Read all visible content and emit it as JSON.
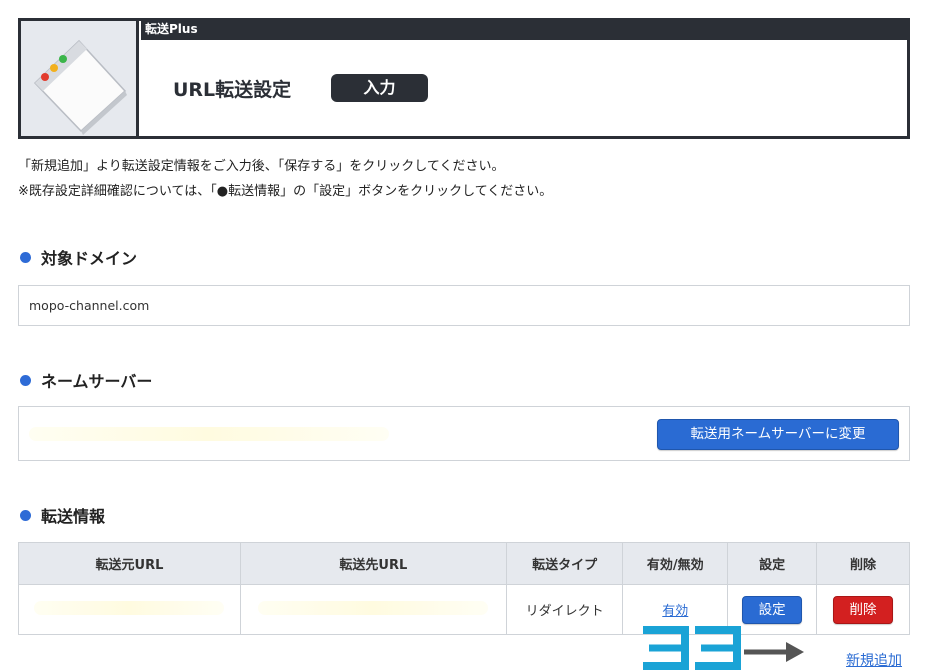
{
  "header": {
    "app_label": "転送Plus",
    "title": "URL転送設定",
    "mode_badge": "入力"
  },
  "instructions": {
    "line1": "「新規追加」より転送設定情報をご入力後、「保存する」をクリックしてください。",
    "line2": "※既存設定詳細確認については、「●転送情報」の「設定」ボタンをクリックしてください。"
  },
  "domain_section": {
    "heading": "対象ドメイン",
    "value": "mopo-channel.com"
  },
  "nameserver_section": {
    "heading": "ネームサーバー",
    "change_button": "転送用ネームサーバーに変更"
  },
  "transfer_section": {
    "heading": "転送情報",
    "columns": [
      "転送元URL",
      "転送先URL",
      "転送タイプ",
      "有効/無効",
      "設定",
      "削除"
    ],
    "rows": [
      {
        "source_url": "",
        "dest_url": "",
        "type": "リダイレクト",
        "status": "有効",
        "settings_btn": "設定",
        "delete_btn": "削除"
      }
    ],
    "new_add_link": "新規追加"
  },
  "annotation": {
    "text": "ココ",
    "color": "#1aa3d6"
  }
}
